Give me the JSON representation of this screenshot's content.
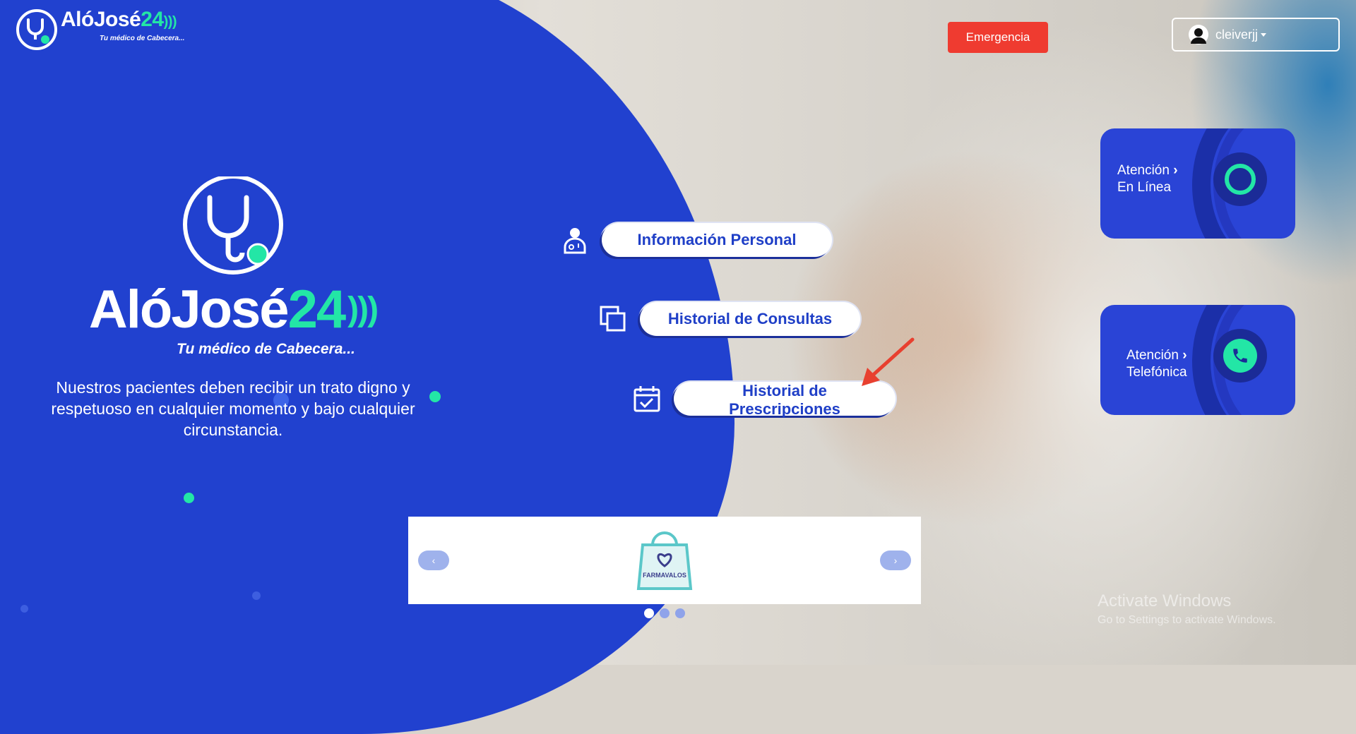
{
  "header": {
    "brand_main": "AlóJosé",
    "brand_num": "24",
    "tagline": "Tu médico de Cabecera...",
    "emergency_label": "Emergencia",
    "user_name": "cleiverjj"
  },
  "hero": {
    "brand_main": "AlóJosé",
    "brand_num": "24",
    "tagline": "Tu médico de Cabecera...",
    "mission": "Nuestros pacientes deben recibir un trato digno y respetuoso en cualquier momento y bajo cualquier circunstancia."
  },
  "menu": [
    {
      "label": "Información Personal",
      "icon": "doctor-icon"
    },
    {
      "label": "Historial de Consultas",
      "icon": "copy-icon"
    },
    {
      "label": "Historial de Prescripciones",
      "icon": "calendar-check-icon"
    }
  ],
  "cards": [
    {
      "line1": "Atención",
      "line2": "En Línea",
      "icon": "ring-icon"
    },
    {
      "line1": "Atención",
      "line2": "Telefónica",
      "icon": "phone-icon"
    }
  ],
  "carousel": {
    "prev": "‹",
    "next": "›",
    "slide_brand": "FARMAVALOS",
    "slides": 3,
    "active_slide": 1
  },
  "watermark": {
    "line1": "Activate Windows",
    "line2": "Go to Settings to activate Windows."
  },
  "colors": {
    "blue": "#2141cf",
    "green": "#23e6a6",
    "red": "#ef3b30"
  }
}
